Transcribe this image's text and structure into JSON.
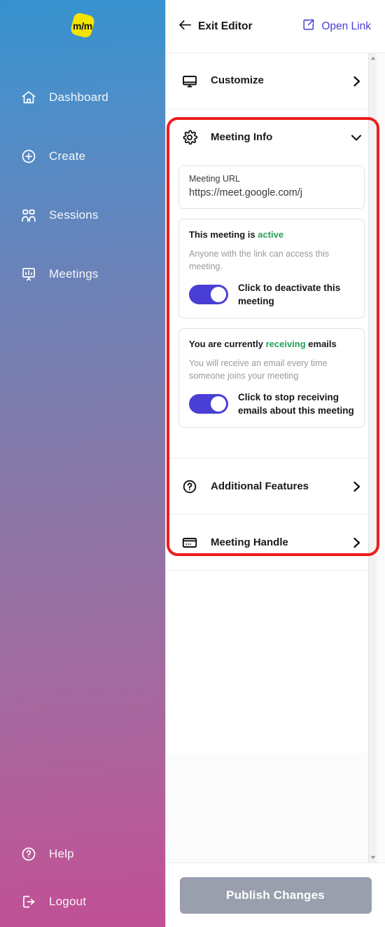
{
  "brand": {
    "logo_text": "m/m",
    "logo_color": "#f5e400"
  },
  "sidebar": {
    "items": [
      {
        "label": "Dashboard",
        "icon": "home-icon"
      },
      {
        "label": "Create",
        "icon": "plus-circle-icon"
      },
      {
        "label": "Sessions",
        "icon": "users-icon"
      },
      {
        "label": "Meetings",
        "icon": "presentation-icon"
      }
    ],
    "bottom_items": [
      {
        "label": "Help",
        "icon": "question-circle-icon"
      },
      {
        "label": "Logout",
        "icon": "logout-icon"
      }
    ],
    "gradient_top": "#3592ce",
    "gradient_bottom": "#c04f95"
  },
  "topbar": {
    "exit_label": "Exit Editor",
    "exit_icon": "arrow-left-icon",
    "open_link_label": "Open Link",
    "open_link_icon": "external-link-icon",
    "open_link_color": "#4a3fd4"
  },
  "sections": {
    "customize": {
      "label": "Customize",
      "icon": "monitor-icon",
      "chevron": "chevron-right-icon"
    },
    "meeting_info": {
      "label": "Meeting Info",
      "icon": "gear-icon",
      "chevron": "chevron-down-icon"
    },
    "additional_features": {
      "label": "Additional Features",
      "icon": "question-circle-icon",
      "chevron": "chevron-right-icon"
    },
    "meeting_handle": {
      "label": "Meeting Handle",
      "icon": "card-icon",
      "chevron": "chevron-right-icon"
    }
  },
  "meeting_info": {
    "url_field": {
      "label": "Meeting URL",
      "value": "https://meet.google.com/j"
    },
    "active_card": {
      "head_prefix": "This meeting is ",
      "head_status": "active",
      "status_color": "#23a259",
      "sub": "Anyone with the link can access this meeting.",
      "toggle_state": "on",
      "toggle_color": "#4a3fd4",
      "toggle_label": "Click to deactivate this meeting"
    },
    "email_card": {
      "head_prefix": "You are currently ",
      "head_status": "receiving",
      "head_suffix": " emails",
      "status_color": "#23a259",
      "sub": "You will receive an email every time someone joins your meeting",
      "toggle_state": "on",
      "toggle_color": "#4a3fd4",
      "toggle_label": "Click to stop receiving emails about this meeting"
    }
  },
  "footer": {
    "publish_label": "Publish Changes",
    "publish_disabled": true,
    "publish_color": "#9a9fae"
  },
  "annotation": {
    "shape": "rounded-rectangle",
    "color": "#ee1c1c",
    "targets": "meeting-info-section"
  }
}
